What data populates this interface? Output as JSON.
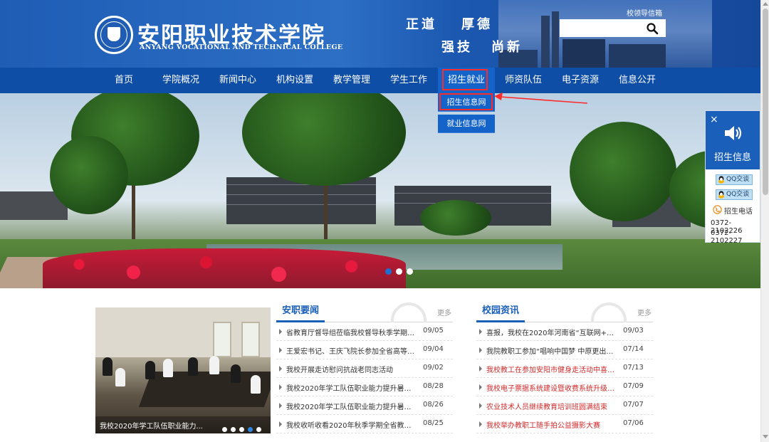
{
  "header": {
    "logo_cn": "安阳职业技术学院",
    "logo_en": "ANYANG VOCATIONAL AND TECHNICAL COLLEGE",
    "motto": [
      "正道",
      "厚德",
      "强技",
      "尚新"
    ],
    "top_link": "校领导信箱",
    "search": {
      "value": "",
      "placeholder": ""
    }
  },
  "nav": {
    "items": [
      "首页",
      "学院概况",
      "新闻中心",
      "机构设置",
      "教学管理",
      "学生工作",
      "招生就业",
      "师资队伍",
      "电子资源",
      "信息公开"
    ],
    "active": "招生就业",
    "dropdown": [
      "招生信息网",
      "就业信息网"
    ]
  },
  "banner": {
    "slides": 3,
    "active_slide": 1
  },
  "side_widget": {
    "close": "×",
    "title": "招生信息",
    "qq_buttons": [
      "QQ交谈",
      "QQ交谈"
    ],
    "phone_label": "招生电话",
    "phones": [
      "0372-2102226",
      "0372-2102227"
    ]
  },
  "photo_news": {
    "caption": "我校2020年学工队伍职业能力...",
    "slides": 5,
    "active_slide": 4
  },
  "columns": [
    {
      "title": "安职要闻",
      "more": "更多",
      "items": [
        {
          "text": "省教育厅督导组莅临我校督导秋季学期疫...",
          "date": "09/05",
          "highlight": false
        },
        {
          "text": "王爱宏书记、王庆飞院长参加全省高等职...",
          "date": "09/04",
          "highlight": false
        },
        {
          "text": "我校开展走访慰问抗战老同志活动",
          "date": "09/02",
          "highlight": false
        },
        {
          "text": "我校2020年学工队伍职业能力提升暑期培...",
          "date": "08/28",
          "highlight": false
        },
        {
          "text": "我校2020年学工队伍职业能力提升暑期培...",
          "date": "08/26",
          "highlight": false
        },
        {
          "text": "我校收听收看2020年秋季学期全省教育系...",
          "date": "08/25",
          "highlight": false
        }
      ]
    },
    {
      "title": "校园资讯",
      "more": "更多",
      "items": [
        {
          "text": "喜报，我校在2020年河南省“互联网+”大...",
          "date": "09/03",
          "highlight": false
        },
        {
          "text": "我院教职工参加“唱响中国梦 中原更出彩...",
          "date": "07/14",
          "highlight": false
        },
        {
          "text": "我校教工在参加安阳市健身走活动中喜获...",
          "date": "07/13",
          "highlight": true
        },
        {
          "text": "我校电子票据系统建设暨收费系统升级专...",
          "date": "07/09",
          "highlight": true
        },
        {
          "text": "农业技术人员继续教育培训班圆满结束",
          "date": "07/07",
          "highlight": true
        },
        {
          "text": "我校举办教职工随手拍公益摄影大赛",
          "date": "07/06",
          "highlight": true
        }
      ]
    }
  ],
  "colors": {
    "header_blue": "#1f5db5",
    "nav_blue": "#0f4ea6",
    "active_blue": "#1463c8",
    "highlight_red": "#ff2a2a",
    "news_red": "#d12a2a"
  }
}
